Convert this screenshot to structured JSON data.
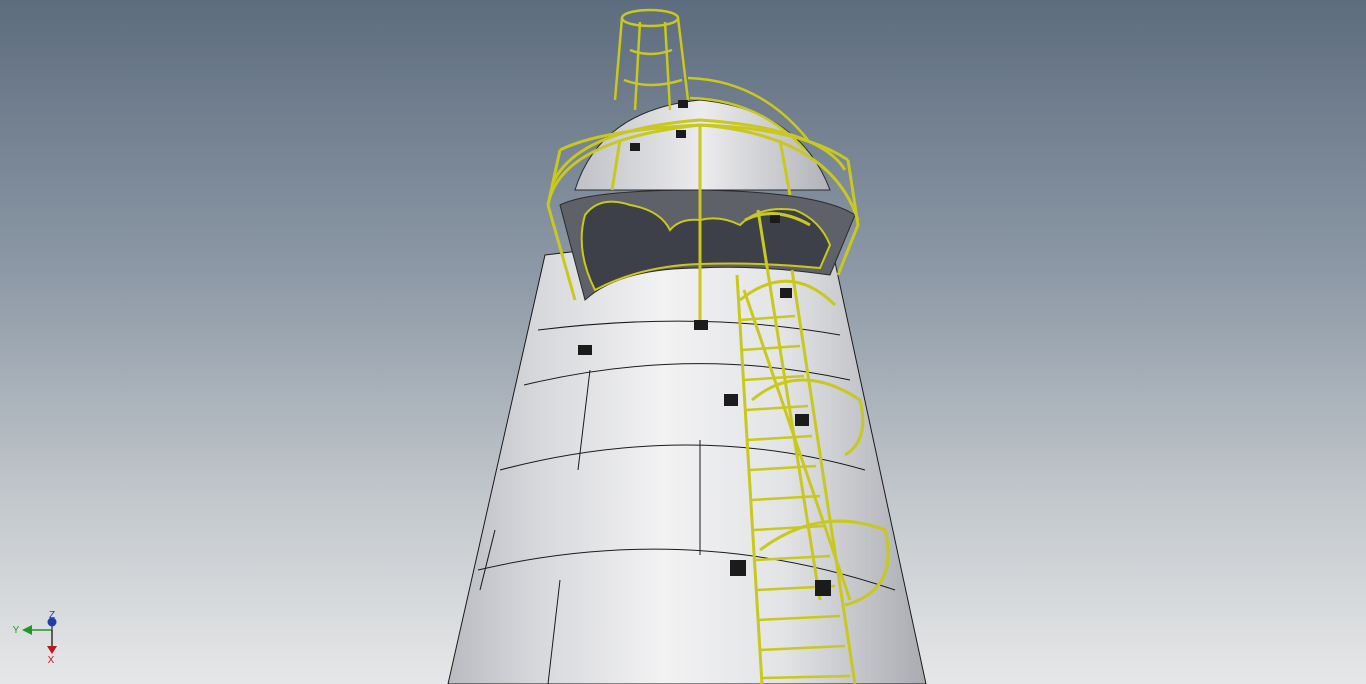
{
  "viewport": {
    "background_top": "#5d6c7e",
    "background_bottom": "#e6e7e8"
  },
  "model": {
    "shell_color": "#d9dadd",
    "seam_color": "#1a1a1a",
    "ladder_color": "#c8c81e",
    "bracket_color": "#1b1b1b"
  },
  "triad": {
    "labels": {
      "y": "Y",
      "z": "Z",
      "x": "X"
    },
    "colors": {
      "y": "#1e9b1e",
      "z": "#1d3fae",
      "x": "#c0141e"
    }
  }
}
